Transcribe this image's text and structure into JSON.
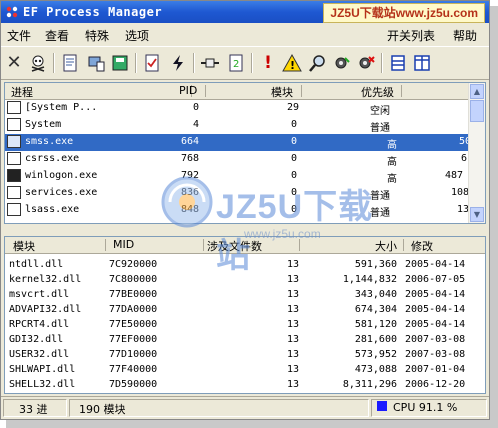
{
  "window": {
    "title": "EF Process Manager",
    "watermark_top": "JZ5U下载站www.jz5u.com"
  },
  "menu": {
    "file": "文件",
    "view": "查看",
    "special": "特殊",
    "options": "选项",
    "toggle_list": "开关列表",
    "help": "帮助"
  },
  "toolbar": {
    "icons": [
      "close-icon",
      "skull-icon",
      "document-icon",
      "computer-icon",
      "disk-icon",
      "checklist-icon",
      "lightning-icon",
      "plug-icon",
      "refresh-icon",
      "exclamation-icon",
      "warning-icon",
      "magnifier-icon",
      "gear-run-icon",
      "gear-stop-icon",
      "list-view-icon",
      "split-view-icon"
    ]
  },
  "process_table": {
    "headers": {
      "name": "进程",
      "pid": "PID",
      "modules": "模块",
      "priority": "优先级"
    },
    "rows": [
      {
        "name": "[System P...",
        "pid": "0",
        "modules": "29",
        "priority": "空闲",
        "extra": ""
      },
      {
        "name": "System",
        "pid": "4",
        "modules": "0",
        "priority": "普通",
        "extra": ""
      },
      {
        "name": "smss.exe",
        "pid": "664",
        "modules": "0",
        "priority": "高",
        "extra": "50"
      },
      {
        "name": "csrss.exe",
        "pid": "768",
        "modules": "0",
        "priority": "高",
        "extra": "6"
      },
      {
        "name": "winlogon.exe",
        "pid": "792",
        "modules": "0",
        "priority": "高",
        "extra": "487"
      },
      {
        "name": "services.exe",
        "pid": "836",
        "modules": "0",
        "priority": "普通",
        "extra": "108"
      },
      {
        "name": "lsass.exe",
        "pid": "848",
        "modules": "0",
        "priority": "普通",
        "extra": "13"
      }
    ],
    "selected_index": 2
  },
  "module_table": {
    "headers": {
      "module": "模块",
      "mid": "MID",
      "files": "涉及文件数",
      "size": "大小",
      "modified": "修改"
    },
    "rows": [
      {
        "module": "ntdll.dll",
        "mid": "7C920000",
        "files": "13",
        "size": "591,360",
        "modified": "2005-04-14"
      },
      {
        "module": "kernel32.dll",
        "mid": "7C800000",
        "files": "13",
        "size": "1,144,832",
        "modified": "2006-07-05"
      },
      {
        "module": "msvcrt.dll",
        "mid": "77BE0000",
        "files": "13",
        "size": "343,040",
        "modified": "2005-04-14"
      },
      {
        "module": "ADVAPI32.dll",
        "mid": "77DA0000",
        "files": "13",
        "size": "674,304",
        "modified": "2005-04-14"
      },
      {
        "module": "RPCRT4.dll",
        "mid": "77E50000",
        "files": "13",
        "size": "581,120",
        "modified": "2005-04-14"
      },
      {
        "module": "GDI32.dll",
        "mid": "77EF0000",
        "files": "13",
        "size": "281,600",
        "modified": "2007-03-08"
      },
      {
        "module": "USER32.dll",
        "mid": "77D10000",
        "files": "13",
        "size": "573,952",
        "modified": "2007-03-08"
      },
      {
        "module": "SHLWAPI.dll",
        "mid": "77F40000",
        "files": "13",
        "size": "473,088",
        "modified": "2007-01-04"
      },
      {
        "module": "SHELL32.dll",
        "mid": "7D590000",
        "files": "13",
        "size": "8,311,296",
        "modified": "2006-12-20"
      }
    ]
  },
  "status": {
    "process_count": "33 进",
    "module_count": "190 模块",
    "cpu": "CPU 91.1 %"
  },
  "watermark_center": {
    "text": "JZ5U下载站",
    "url": "www.jz5u.com"
  },
  "colors": {
    "title_blue": "#1e58d2",
    "selection": "#316ac5",
    "cpu_indicator": "#1a1aff"
  }
}
